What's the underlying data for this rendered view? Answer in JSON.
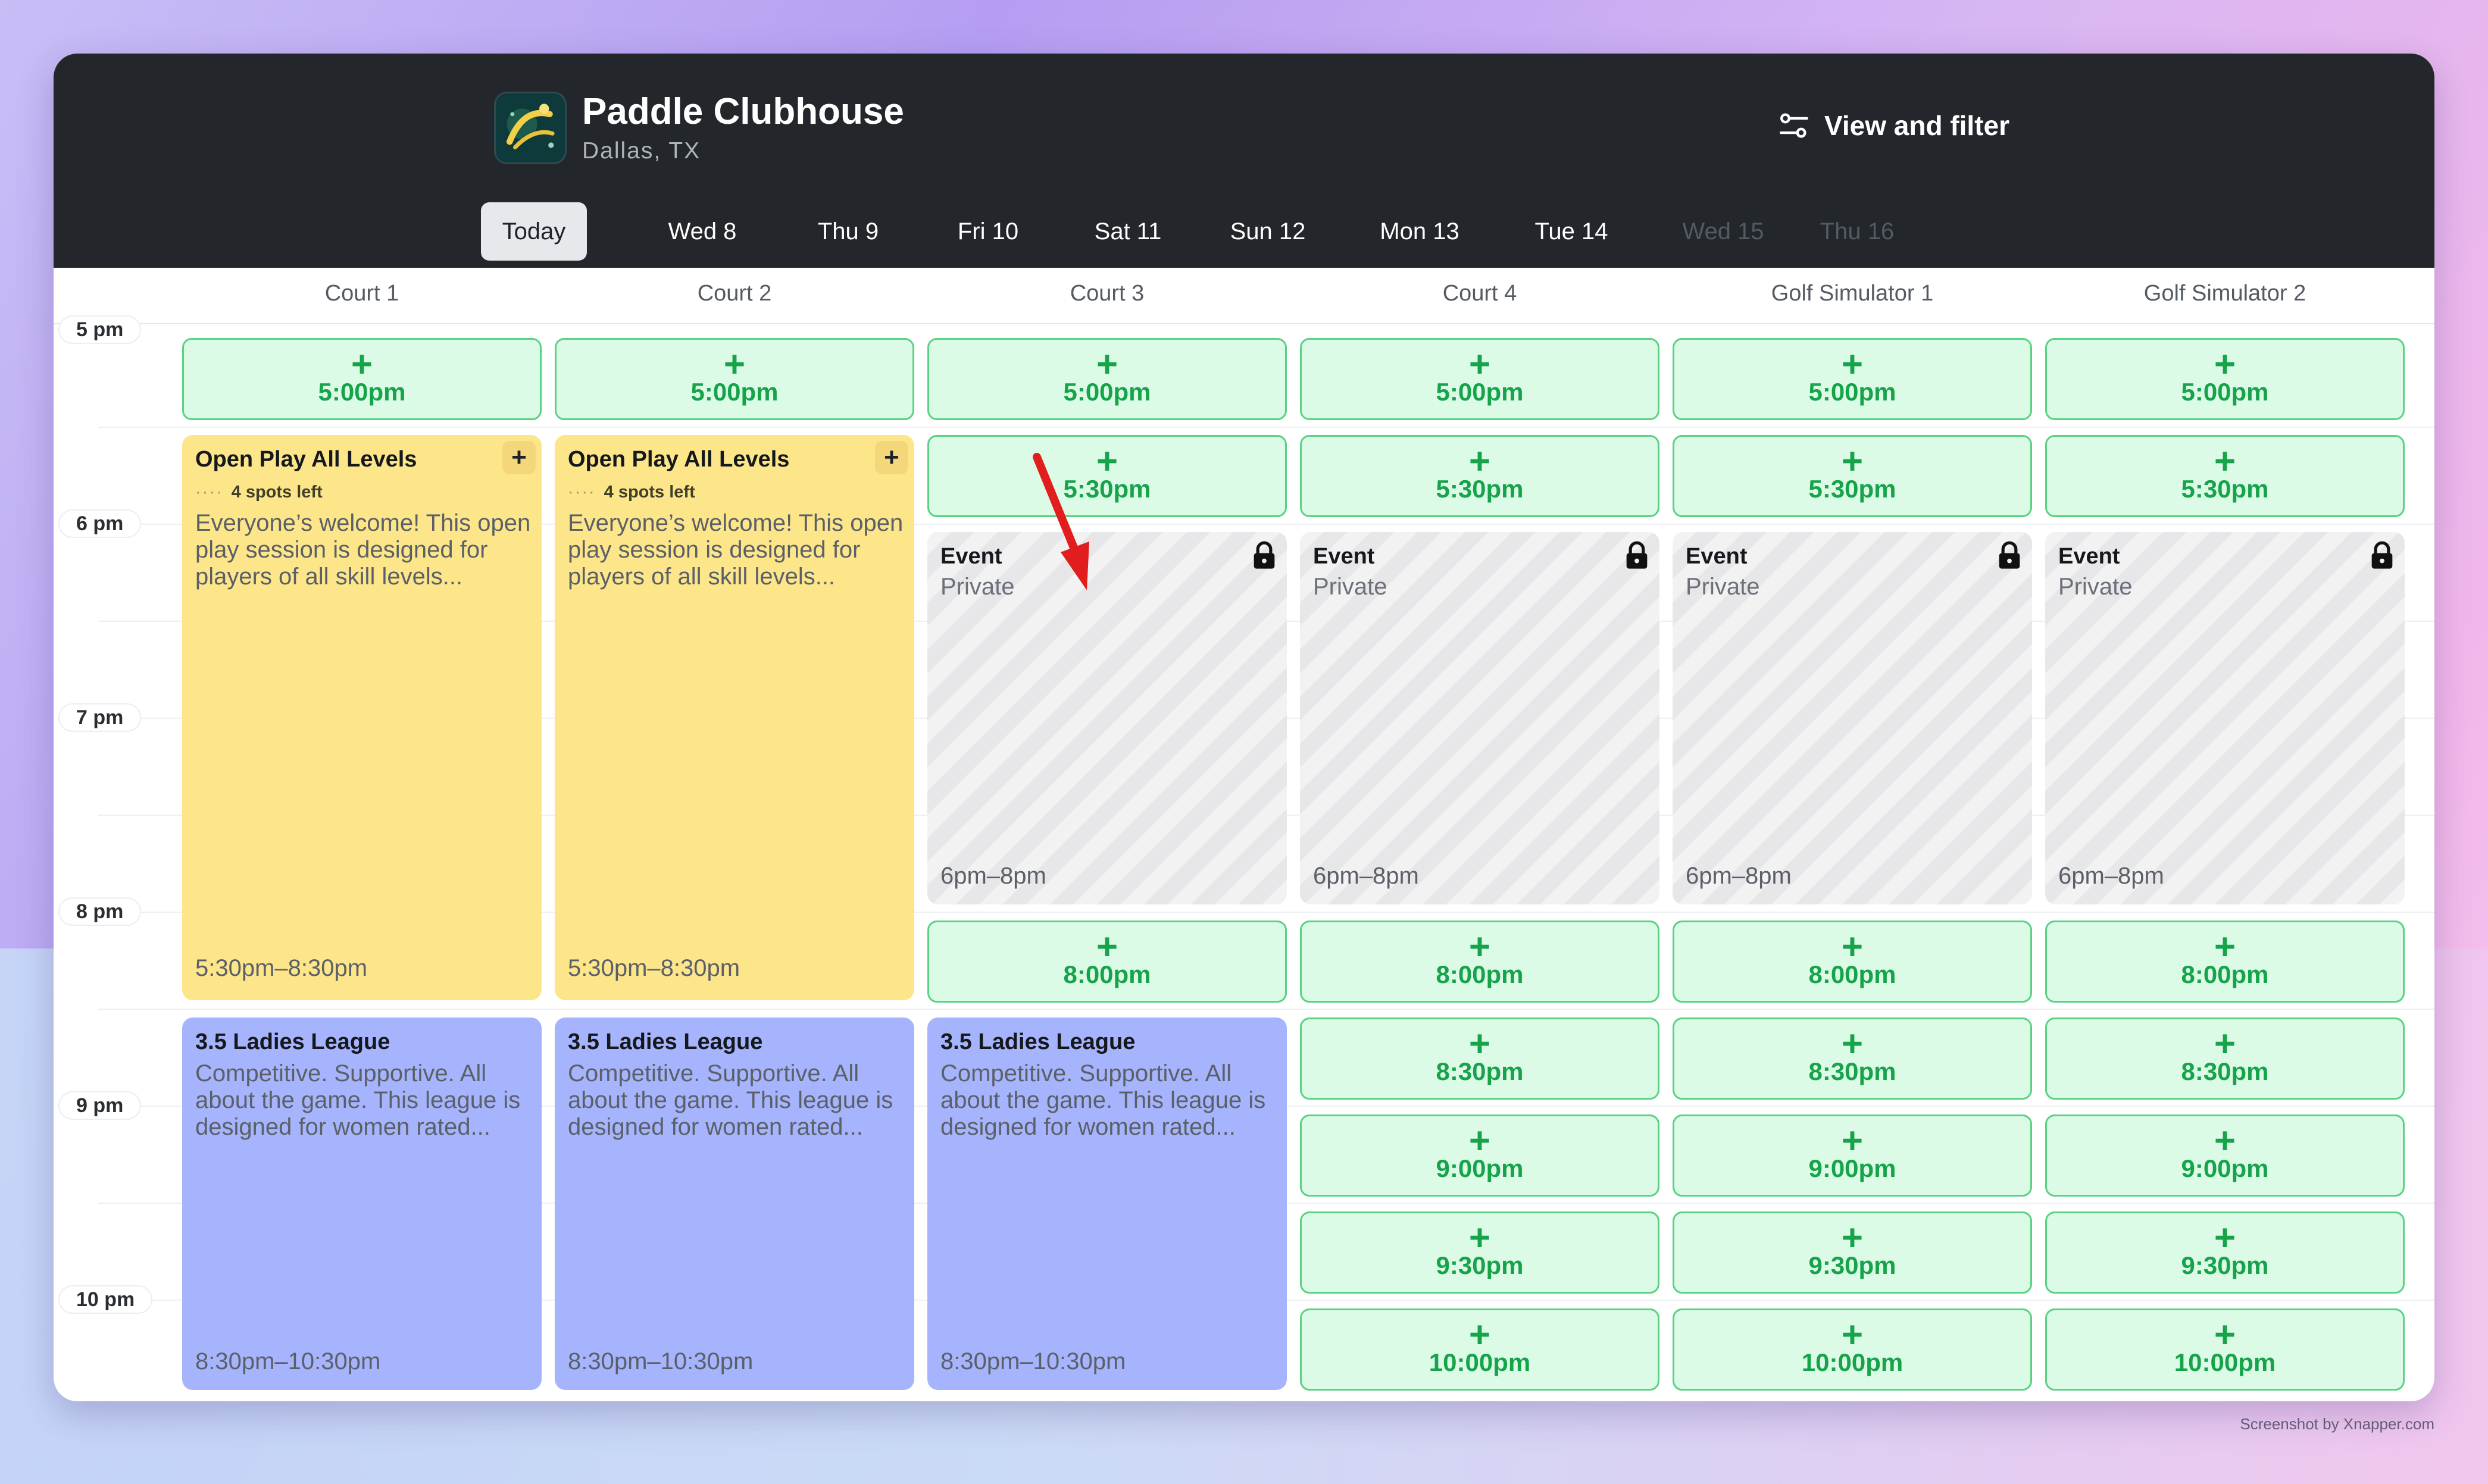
{
  "club": {
    "name": "Paddle Clubhouse",
    "location": "Dallas, TX",
    "view_filter_label": "View and filter"
  },
  "days": [
    {
      "label": "Today",
      "state": "active"
    },
    {
      "label": "Wed 8",
      "state": "enabled"
    },
    {
      "label": "Thu 9",
      "state": "enabled"
    },
    {
      "label": "Fri 10",
      "state": "enabled"
    },
    {
      "label": "Sat 11",
      "state": "enabled"
    },
    {
      "label": "Sun 12",
      "state": "enabled"
    },
    {
      "label": "Mon 13",
      "state": "enabled"
    },
    {
      "label": "Tue 14",
      "state": "enabled"
    },
    {
      "label": "Wed 15",
      "state": "disabled"
    },
    {
      "label": "Thu 16",
      "state": "disabled"
    }
  ],
  "columns": [
    "Court 1",
    "Court 2",
    "Court 3",
    "Court 4",
    "Golf Simulator 1",
    "Golf Simulator 2"
  ],
  "time_labels": [
    "5 pm",
    "6 pm",
    "7 pm",
    "8 pm",
    "9 pm",
    "10 pm"
  ],
  "slot_plus": "+",
  "slots": {
    "t500": "5:00pm",
    "t530": "5:30pm",
    "t800": "8:00pm",
    "t830": "8:30pm",
    "t900": "9:00pm",
    "t930": "9:30pm",
    "t1000": "10:00pm"
  },
  "open_play": {
    "title": "Open Play All Levels",
    "spots_dots": "····",
    "spots": "4 spots left",
    "description": "Everyone’s welcome! This open play session is designed for players of all skill levels...",
    "time": "5:30pm–8:30pm",
    "add": "+"
  },
  "event": {
    "title": "Event",
    "subtitle": "Private",
    "time": "6pm–8pm"
  },
  "league": {
    "title": "3.5 Ladies League",
    "description": "Competitive. Supportive. All about the game. This league is designed for women rated...",
    "time": "8:30pm–10:30pm"
  },
  "colors": {
    "header_bg": "#23272c",
    "slot_bg": "#dcfbe7",
    "slot_border": "#59d283",
    "slot_text": "#16a34a",
    "open_play_bg": "#fde68a",
    "league_bg": "#a5b4fc",
    "annotation_arrow": "#e11d1d"
  },
  "watermark": "Screenshot by Xnapper.com"
}
